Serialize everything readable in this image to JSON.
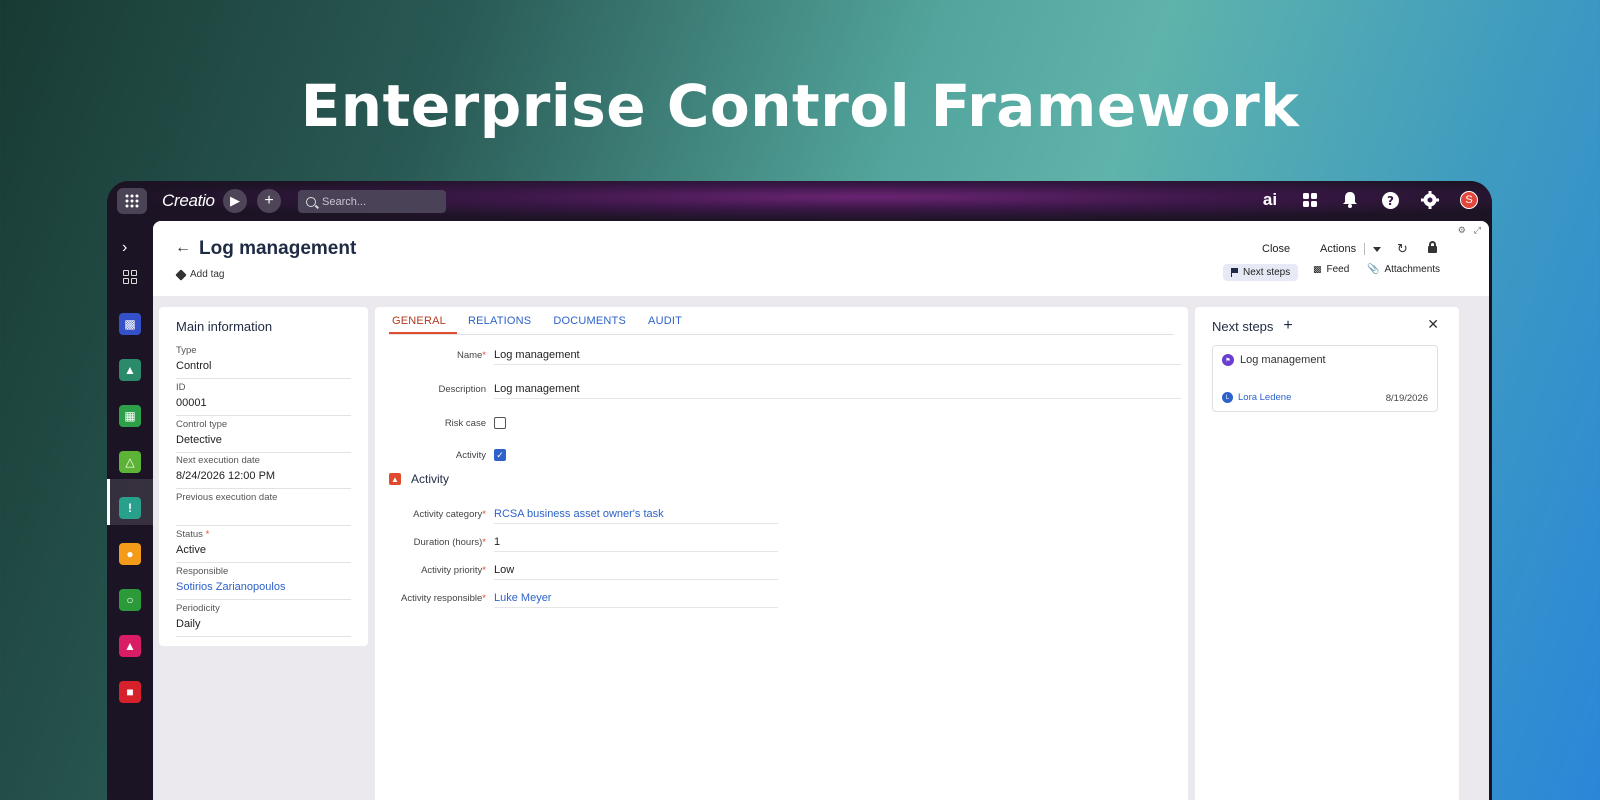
{
  "hero": {
    "title": "Enterprise Control Framework"
  },
  "topbar": {
    "logo": "Creatio",
    "search_placeholder": "Search...",
    "ai_label": "ai",
    "avatar_initial": "S"
  },
  "nav": {
    "items": [
      {
        "icon": "clipboard-icon",
        "color": "#3451c9"
      },
      {
        "icon": "contact-book-icon",
        "color": "#2a8a6a"
      },
      {
        "icon": "building-icon",
        "color": "#2ca14a"
      },
      {
        "icon": "recycle-icon",
        "color": "#5db335"
      },
      {
        "icon": "warning-icon",
        "color": "#29a08c"
      },
      {
        "icon": "person-badge-icon",
        "color": "#f49b1a"
      },
      {
        "icon": "document-search-icon",
        "color": "#2d9a3a"
      },
      {
        "icon": "person-chart-icon",
        "color": "#d91c66"
      },
      {
        "icon": "pdf-document-icon",
        "color": "#d6212b"
      }
    ]
  },
  "header": {
    "title": "Log management",
    "add_tag": "Add tag",
    "close": "Close",
    "actions": "Actions",
    "right_tabs": [
      "Next steps",
      "Feed",
      "Attachments"
    ]
  },
  "main_info": {
    "title": "Main information",
    "fields": [
      {
        "label": "Type",
        "value": "Control"
      },
      {
        "label": "ID",
        "value": "00001"
      },
      {
        "label": "Control type",
        "value": "Detective"
      },
      {
        "label": "Next execution date",
        "value": "8/24/2026 12:00 PM"
      },
      {
        "label": "Previous execution date",
        "value": ""
      },
      {
        "label": "Status",
        "value": "Active",
        "required": "*"
      },
      {
        "label": "Responsible",
        "value": "Sotirios Zarianopoulos"
      },
      {
        "label": "Periodicity",
        "value": "Daily"
      }
    ]
  },
  "center": {
    "tabs": [
      "GENERAL",
      "RELATIONS",
      "DOCUMENTS",
      "AUDIT"
    ],
    "name_label": "Name",
    "name_value": "Log management",
    "description_label": "Description",
    "description_value": "Log management",
    "risk_case_label": "Risk case",
    "risk_case_checked": false,
    "activity_label": "Activity",
    "activity_checked": true,
    "section_title": "Activity",
    "activity_category_label": "Activity category",
    "activity_category_value": "RCSA business asset owner's task",
    "duration_label": "Duration (hours)",
    "duration_value": "1",
    "priority_label": "Activity priority",
    "priority_value": "Low",
    "responsible_label": "Activity responsible",
    "responsible_value": "Luke Meyer",
    "required_mark": "*"
  },
  "next_steps": {
    "title": "Next steps",
    "card_title": "Log management",
    "user": "Lora Ledene",
    "user_initial": "L",
    "date": "8/19/2026"
  },
  "colors": {
    "accent": "#2e62c9",
    "required": "#e04a2f"
  }
}
